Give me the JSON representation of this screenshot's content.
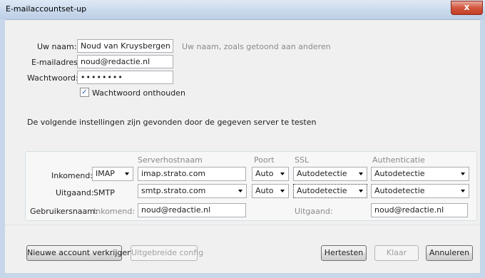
{
  "window": {
    "title": "E-mailaccountset-up",
    "close_glyph": "x"
  },
  "identity": {
    "name_label": "Uw naam:",
    "name_value": "Noud van Kruysbergen",
    "name_hint": "Uw naam, zoals getoond aan anderen",
    "email_label": "E-mailadres:",
    "email_value": "noud@redactie.nl",
    "password_label": "Wachtwoord:",
    "password_value": "••••••••",
    "remember_label": "Wachtwoord onthouden",
    "remember_checked": true,
    "check_glyph": "✓"
  },
  "status_text": "De volgende instellingen zijn gevonden door de gegeven server te testen",
  "settings": {
    "headers": {
      "host": "Serverhostnaam",
      "port": "Poort",
      "ssl": "SSL",
      "auth": "Authenticatie"
    },
    "incoming": {
      "label": "Inkomend:",
      "protocol": "IMAP",
      "host": "imap.strato.com",
      "port": "Auto",
      "ssl": "Autodetectie",
      "auth": "Autodetectie"
    },
    "outgoing": {
      "label": "Uitgaand:",
      "protocol": "SMTP",
      "host": "smtp.strato.com",
      "port": "Auto",
      "ssl": "Autodetectie",
      "auth": "Autodetectie"
    },
    "username": {
      "label": "Gebruikersnaam:",
      "incoming_label": "Inkomend:",
      "incoming_value": "noud@redactie.nl",
      "outgoing_label": "Uitgaand:",
      "outgoing_value": "noud@redactie.nl"
    }
  },
  "buttons": {
    "new_account": "Nieuwe account verkrijgen",
    "advanced": "Uitgebreide config",
    "retest": "Hertesten",
    "done": "Klaar",
    "cancel": "Annuleren"
  }
}
